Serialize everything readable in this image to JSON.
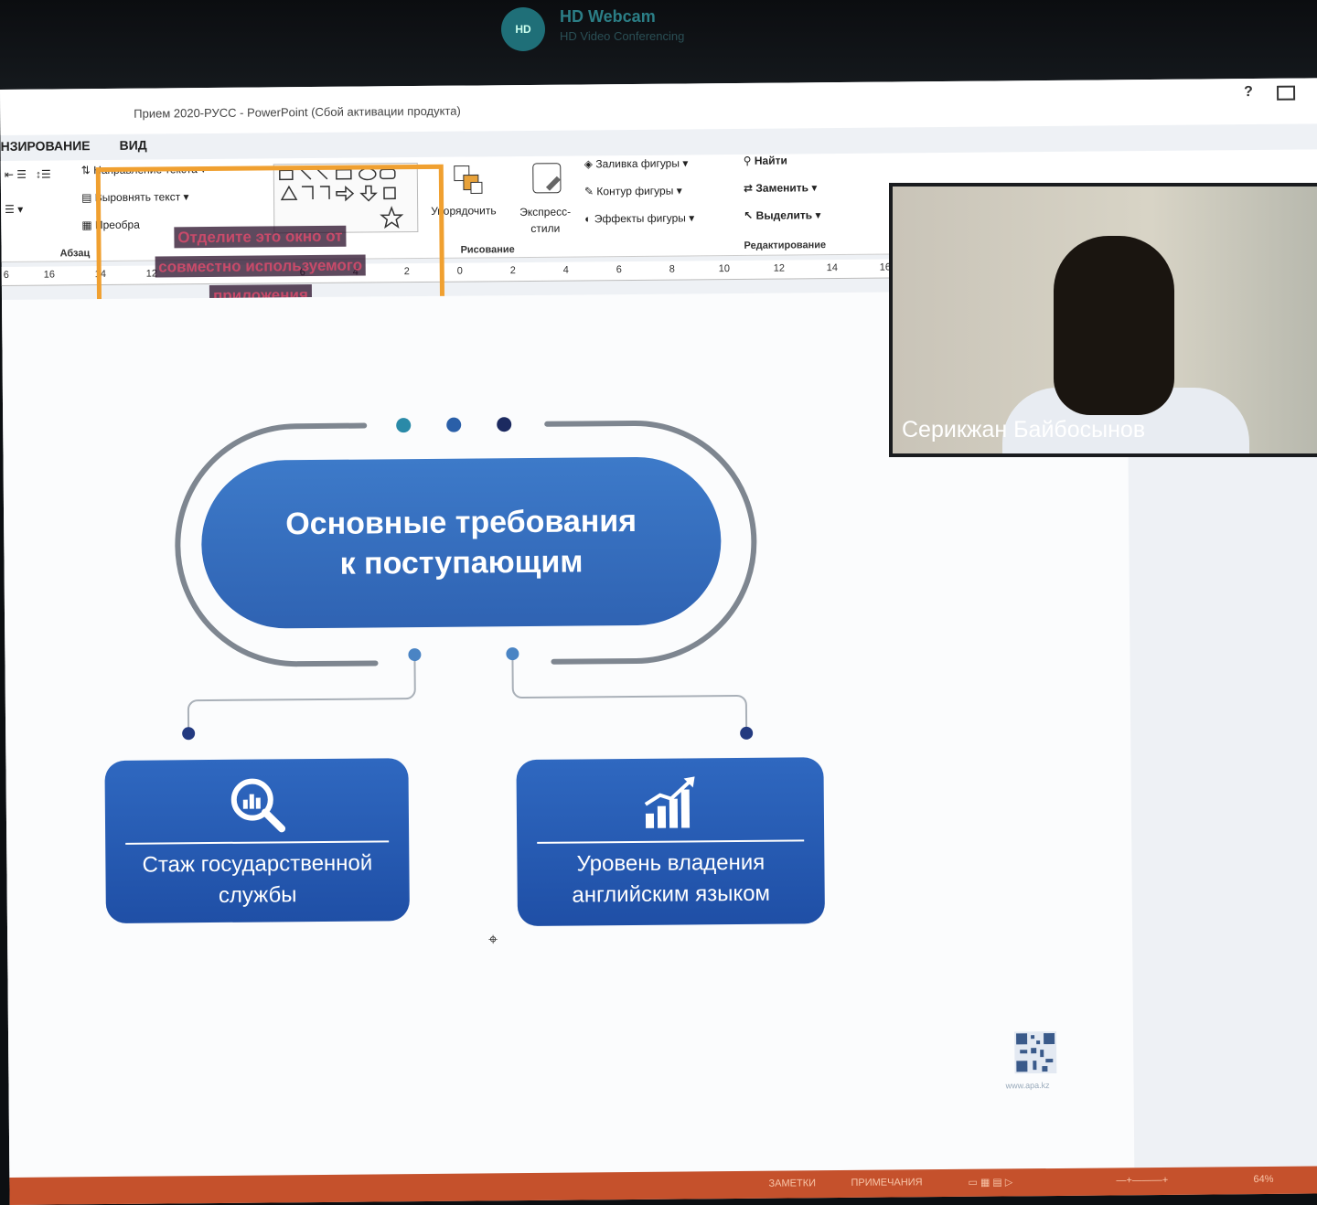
{
  "webcam": {
    "logo": "HD",
    "title": "HD Webcam",
    "subtitle": "HD Video Conferencing"
  },
  "window": {
    "title": "Прием 2020-РУСС - PowerPoint (Сбой активации продукта)",
    "help": "?"
  },
  "tabs": [
    "НЗИРОВАНИЕ",
    "ВИД"
  ],
  "ribbon": {
    "text_direction": "Направление текста",
    "align_text": "Выровнять текст",
    "convert": "Преобра",
    "paragraph_group": "Абзац",
    "arrange": "Упорядочить",
    "quick_styles": "Экспресс-стили",
    "drawing_group": "Рисование",
    "shape_fill": "Заливка фигуры",
    "shape_outline": "Контур фигуры",
    "shape_effects": "Эффекты фигуры",
    "find": "Найти",
    "replace": "Заменить",
    "select": "Выделить",
    "editing_group": "Редактирование"
  },
  "ruler_labels": [
    "6",
    "16",
    "14",
    "12",
    "4",
    "6",
    "2",
    "0",
    "2",
    "4",
    "6",
    "8",
    "10",
    "12",
    "14",
    "16"
  ],
  "overlay_message": [
    "Отделите это окно от",
    "совместно используемого",
    "приложения"
  ],
  "slide": {
    "main_title_line1": "Основные требования",
    "main_title_line2": "к поступающим",
    "card1_line1": "Стаж государственной",
    "card1_line2": "службы",
    "card2_line1": "Уровень владения",
    "card2_line2": "английским языком",
    "qr_caption": "www.apa.kz",
    "accent_dark": "#1f4fa6",
    "accent_light": "#3d7ac9",
    "dot_teal": "#2a8aa8",
    "dot_navy": "#233a80"
  },
  "video": {
    "participant_name": "Серикжан Байбосынов"
  },
  "statusbar": {
    "notes": "ЗАМЕТКИ",
    "comments": "ПРИМЕЧАНИЯ",
    "zoom": "64%"
  }
}
